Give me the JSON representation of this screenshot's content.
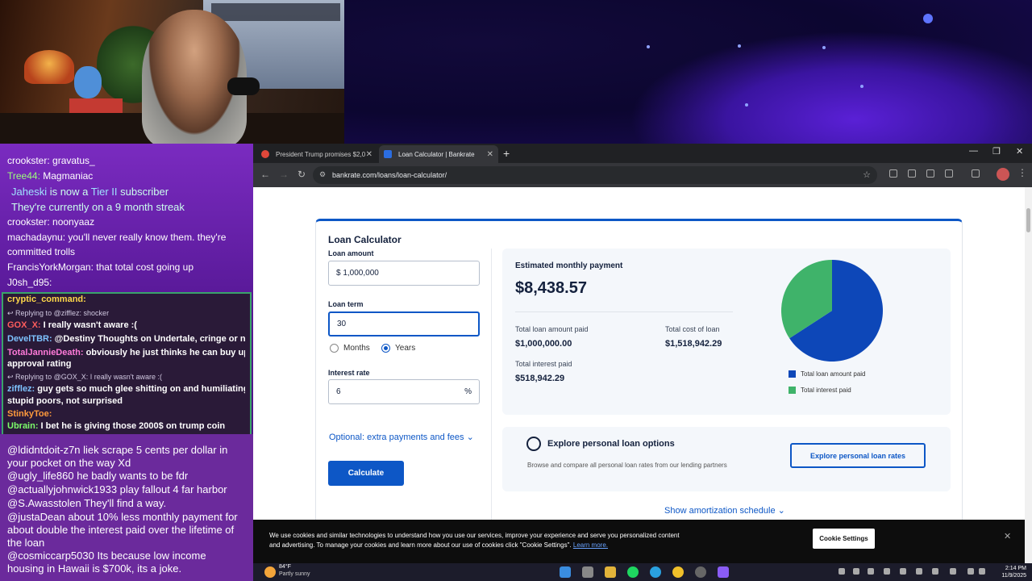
{
  "chat": {
    "top_lines": [
      {
        "user": "crookster:",
        "text": " gravatus_",
        "color": "#ffffff"
      },
      {
        "user": "Tree44:",
        "text": " Magmaniac",
        "color": "#9cff7a"
      },
      {
        "user": "Jaheski",
        "text": " is now a ",
        "extra": "Tier II",
        "tail": " subscriber",
        "color": "#9fe3ff"
      },
      {
        "user": "",
        "text": "They're currently on a 9 month streak",
        "color": "#ffffff"
      },
      {
        "user": "crookster:",
        "text": " noonyaaz",
        "color": "#ffffff"
      },
      {
        "user": "machadaynu:",
        "text": " you'll never really know them. they're",
        "color": "#ffffff"
      },
      {
        "user": "",
        "text": "committed trolls",
        "color": "#ffffff"
      },
      {
        "user": "FrancisYorkMorgan:",
        "text": " that total cost going up",
        "color": "#ffffff"
      },
      {
        "user": "J0sh_d95:",
        "text": "",
        "color": "#ffffff"
      }
    ],
    "mid_lines": [
      {
        "user": "cryptic_command:",
        "text": "",
        "color": "#ffd84a",
        "type": "mc"
      },
      {
        "user": "",
        "text": "↩ Replying to @zifflez: shocker",
        "color": "#d0c8e0",
        "type": "rp"
      },
      {
        "user": "GOX_X:",
        "text": " I really wasn't aware :(",
        "color": "#ff5d5d",
        "type": "mc"
      },
      {
        "user": "DevelTBR:",
        "text": " @Destiny Thoughts on Undertale, cringe or no?",
        "color": "#7ec3ff",
        "type": "mc"
      },
      {
        "user": "TotalJannieDeath:",
        "text": " obviously he just thinks he can buy up his",
        "color": "#ff7ad9",
        "type": "mc"
      },
      {
        "user": "",
        "text": "approval rating",
        "color": "#ffffff",
        "type": "mc"
      },
      {
        "user": "",
        "text": "↩ Replying to @GOX_X: I really wasn't aware :(",
        "color": "#d0c8e0",
        "type": "rp"
      },
      {
        "user": "zifflez:",
        "text": " guy gets so much glee shitting on and humiliating",
        "color": "#7ec3ff",
        "type": "mc"
      },
      {
        "user": "",
        "text": "stupid poors, not surprised",
        "color": "#ffffff",
        "type": "mc"
      },
      {
        "user": "StinkyToe:",
        "text": "",
        "color": "#ff9a3c",
        "type": "mc"
      },
      {
        "user": "Ubrain:",
        "text": " I bet he is giving those 2000$ on trump coin",
        "color": "#7cff6a",
        "type": "mc"
      }
    ],
    "bottom_lines": [
      "@ldidntdoit-z7n liek scrape 5 cents per dollar in your pocket on the way Xd",
      "@ugly_life860 he badly wants to be fdr",
      "@actuallyjohnwick1933 play fallout 4 far harbor",
      "@S.Awasstolen They'll find a way.",
      "@justaDean about 10% less monthly payment for about double the interest paid over the lifetime of the loan",
      "@cosmiccarp5030 Its because low income housing in Hawaii is $700k, its a joke."
    ]
  },
  "browser": {
    "tabs": [
      {
        "title": "President Trump promises $2,0",
        "icon_color": "#e0473a"
      },
      {
        "title": "Loan Calculator | Bankrate",
        "icon_color": "#2b6de0"
      }
    ],
    "url": "bankrate.com/loans/loan-calculator/"
  },
  "calculator": {
    "title": "Loan Calculator",
    "loan_amount_label": "Loan amount",
    "loan_amount_value": "$  1,000,000",
    "loan_term_label": "Loan term",
    "loan_term_value": "30",
    "months_label": "Months",
    "years_label": "Years",
    "interest_rate_label": "Interest rate",
    "interest_rate_value": "6",
    "percent_symbol": "%",
    "optional_link": "Optional: extra payments and fees",
    "calculate_button": "Calculate"
  },
  "result": {
    "title": "Estimated monthly payment",
    "monthly_payment": "$8,438.57",
    "total_loan_label": "Total loan amount paid",
    "total_loan_value": "$1,000,000.00",
    "total_cost_label": "Total cost of loan",
    "total_cost_value": "$1,518,942.29",
    "total_interest_label": "Total interest paid",
    "total_interest_value": "$518,942.29",
    "legend_principal": "Total loan amount paid",
    "legend_interest": "Total interest paid",
    "principal_color": "#0d47b8",
    "interest_color": "#3fb36a",
    "pie_values": [
      1000000.0,
      518942.29
    ]
  },
  "explore": {
    "title": "Explore personal loan options",
    "subtitle": "Browse and compare all personal loan rates from our lending partners",
    "button": "Explore personal loan rates",
    "amortization_link": "Show amortization schedule"
  },
  "cookie": {
    "text": "We use cookies and similar technologies to understand how you use our services, improve your experience and serve you personalized content and advertising. To manage your cookies and learn more about our use of cookies click \"Cookie Settings\".",
    "learn_more": "Learn more.",
    "button": "Cookie Settings"
  },
  "taskbar": {
    "temperature": "84°F",
    "condition": "Partly sunny",
    "time": "2:14 PM",
    "date": "11/9/2025"
  }
}
